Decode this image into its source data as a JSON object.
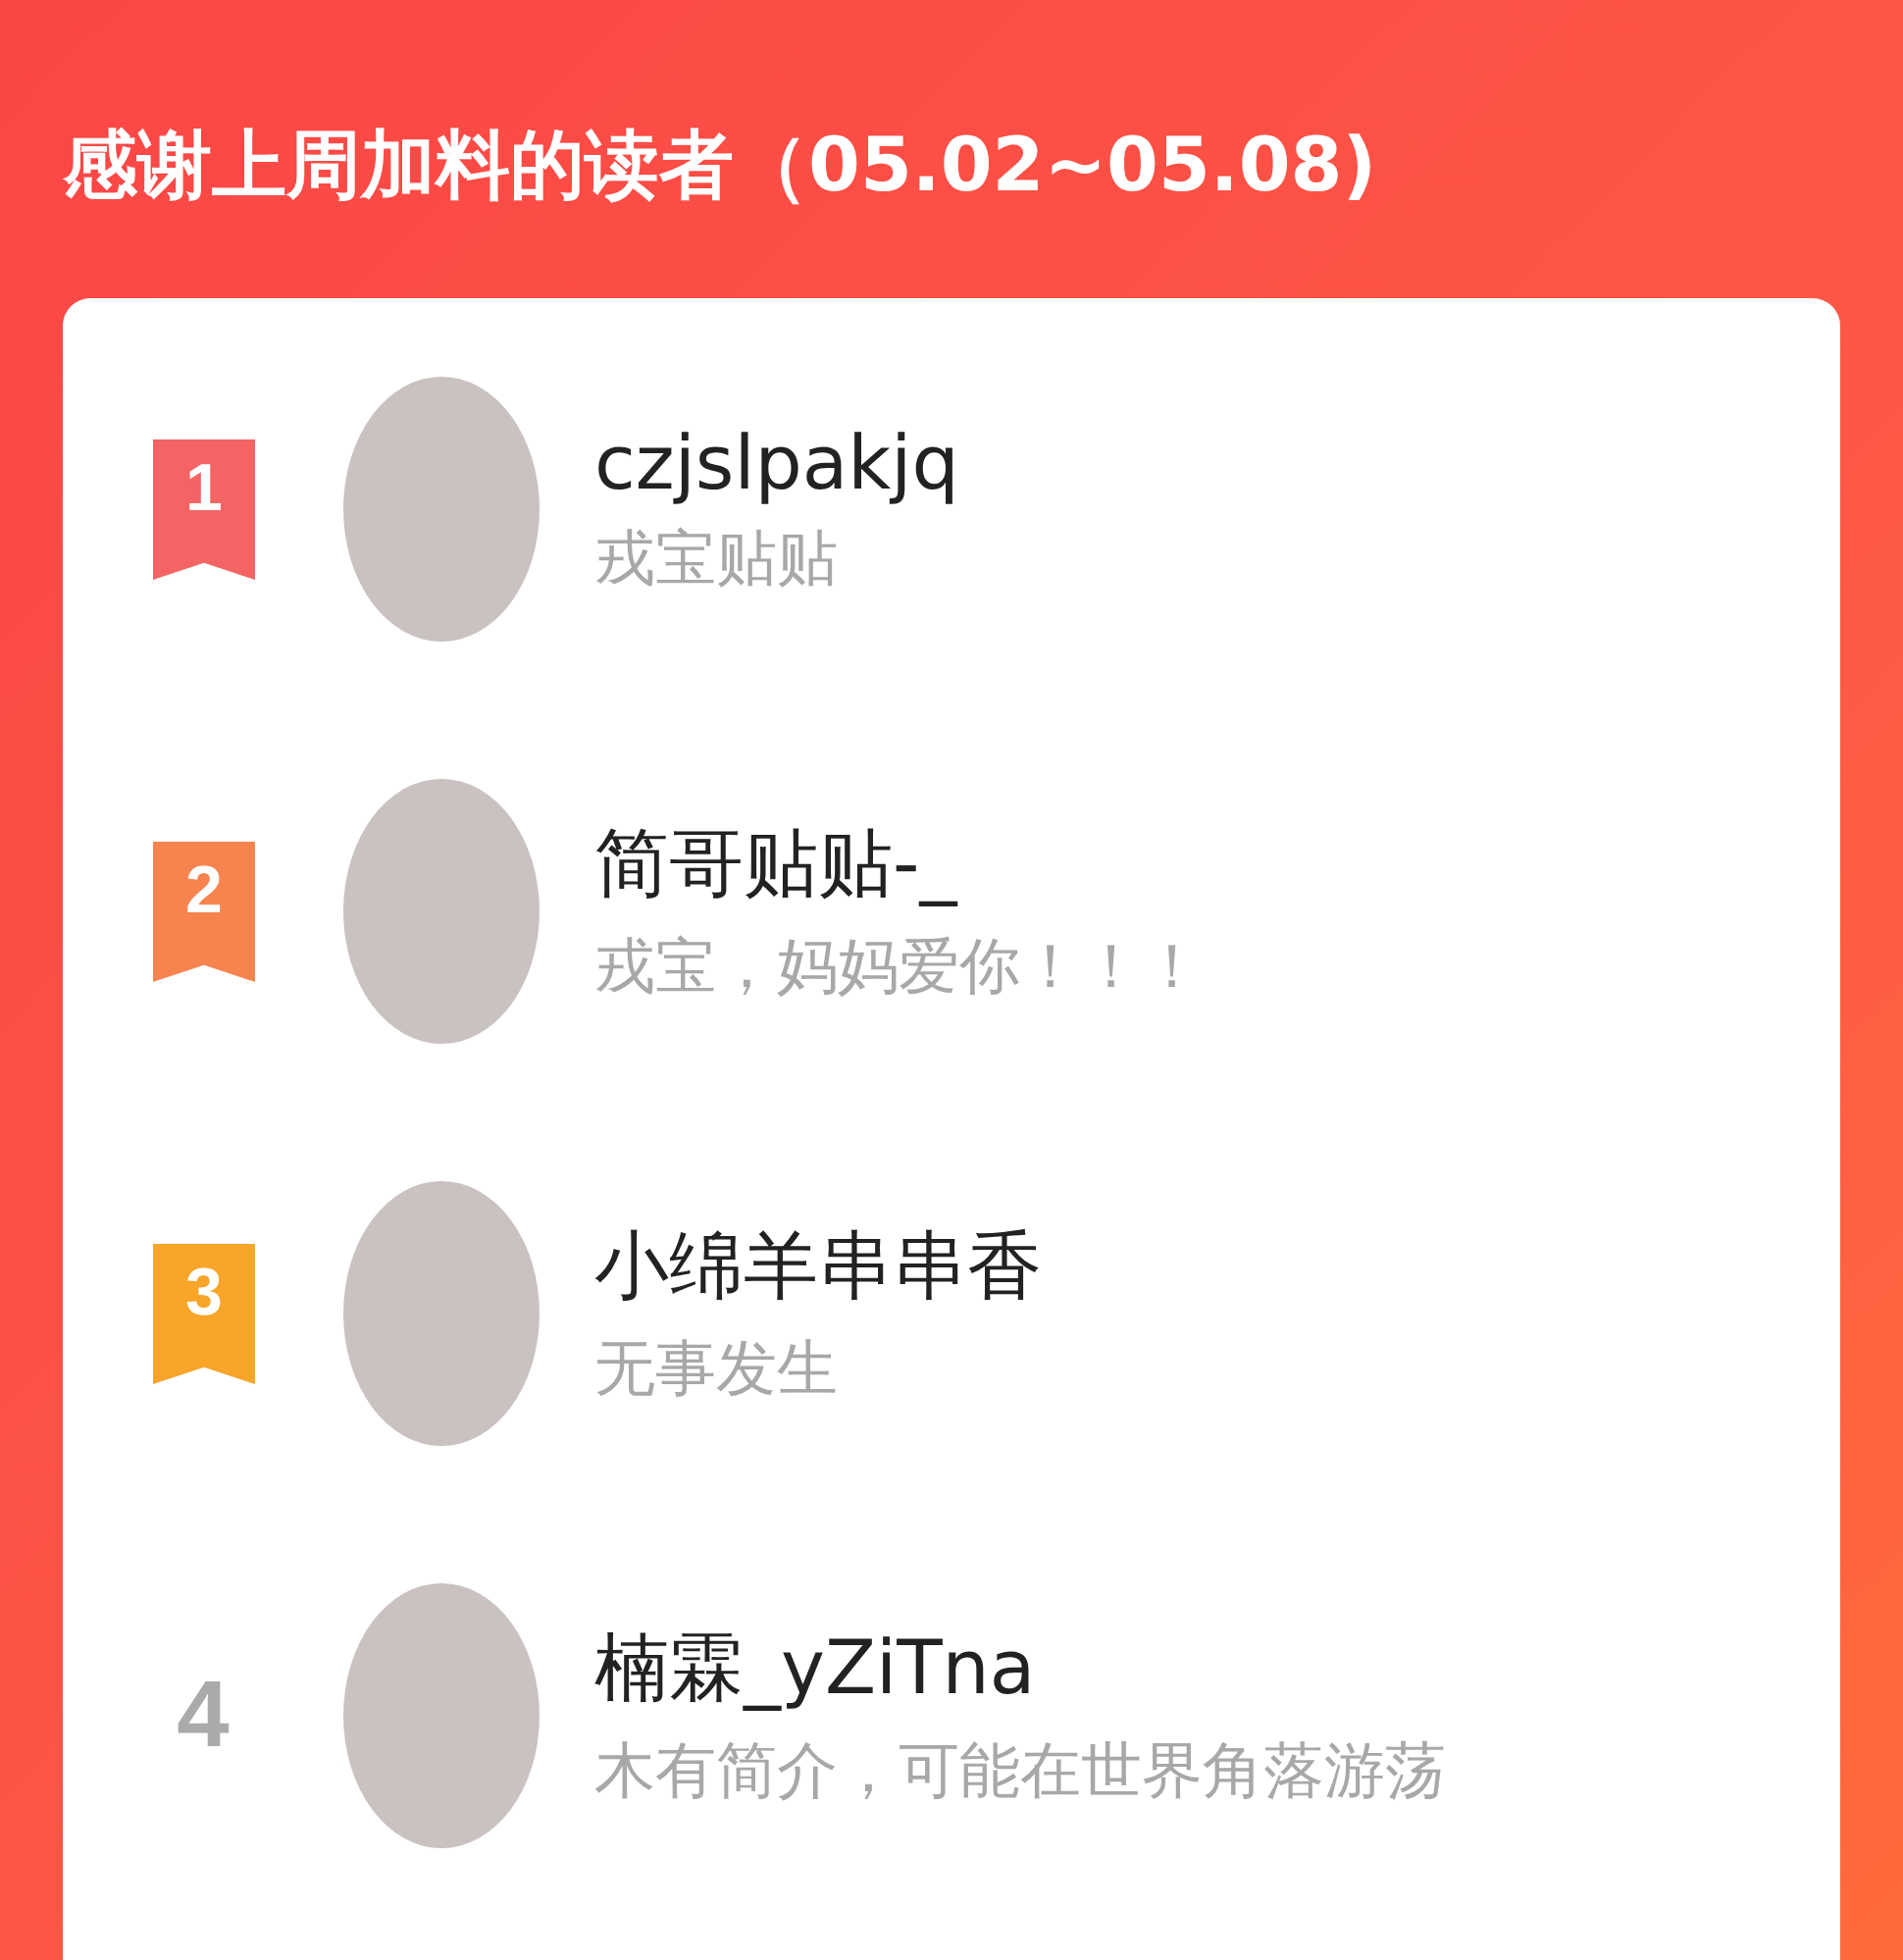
{
  "title": "感谢上周加料的读者（05.02~05.08)",
  "readers": [
    {
      "rank": "1",
      "kind": "ribbon",
      "color": "#f46464",
      "name": "czjslpakjq",
      "bio": "戎宝贴贴"
    },
    {
      "rank": "2",
      "kind": "ribbon",
      "color": "#f7844f",
      "name": "简哥贴贴-_",
      "bio": "戎宝，妈妈爱你！！！"
    },
    {
      "rank": "3",
      "kind": "ribbon",
      "color": "#f8a52a",
      "name": "小绵羊串串香",
      "bio": "无事发生"
    },
    {
      "rank": "4",
      "kind": "plain",
      "name": "楠霖_yZiTna",
      "bio": "木有简介，可能在世界角落游荡"
    }
  ]
}
